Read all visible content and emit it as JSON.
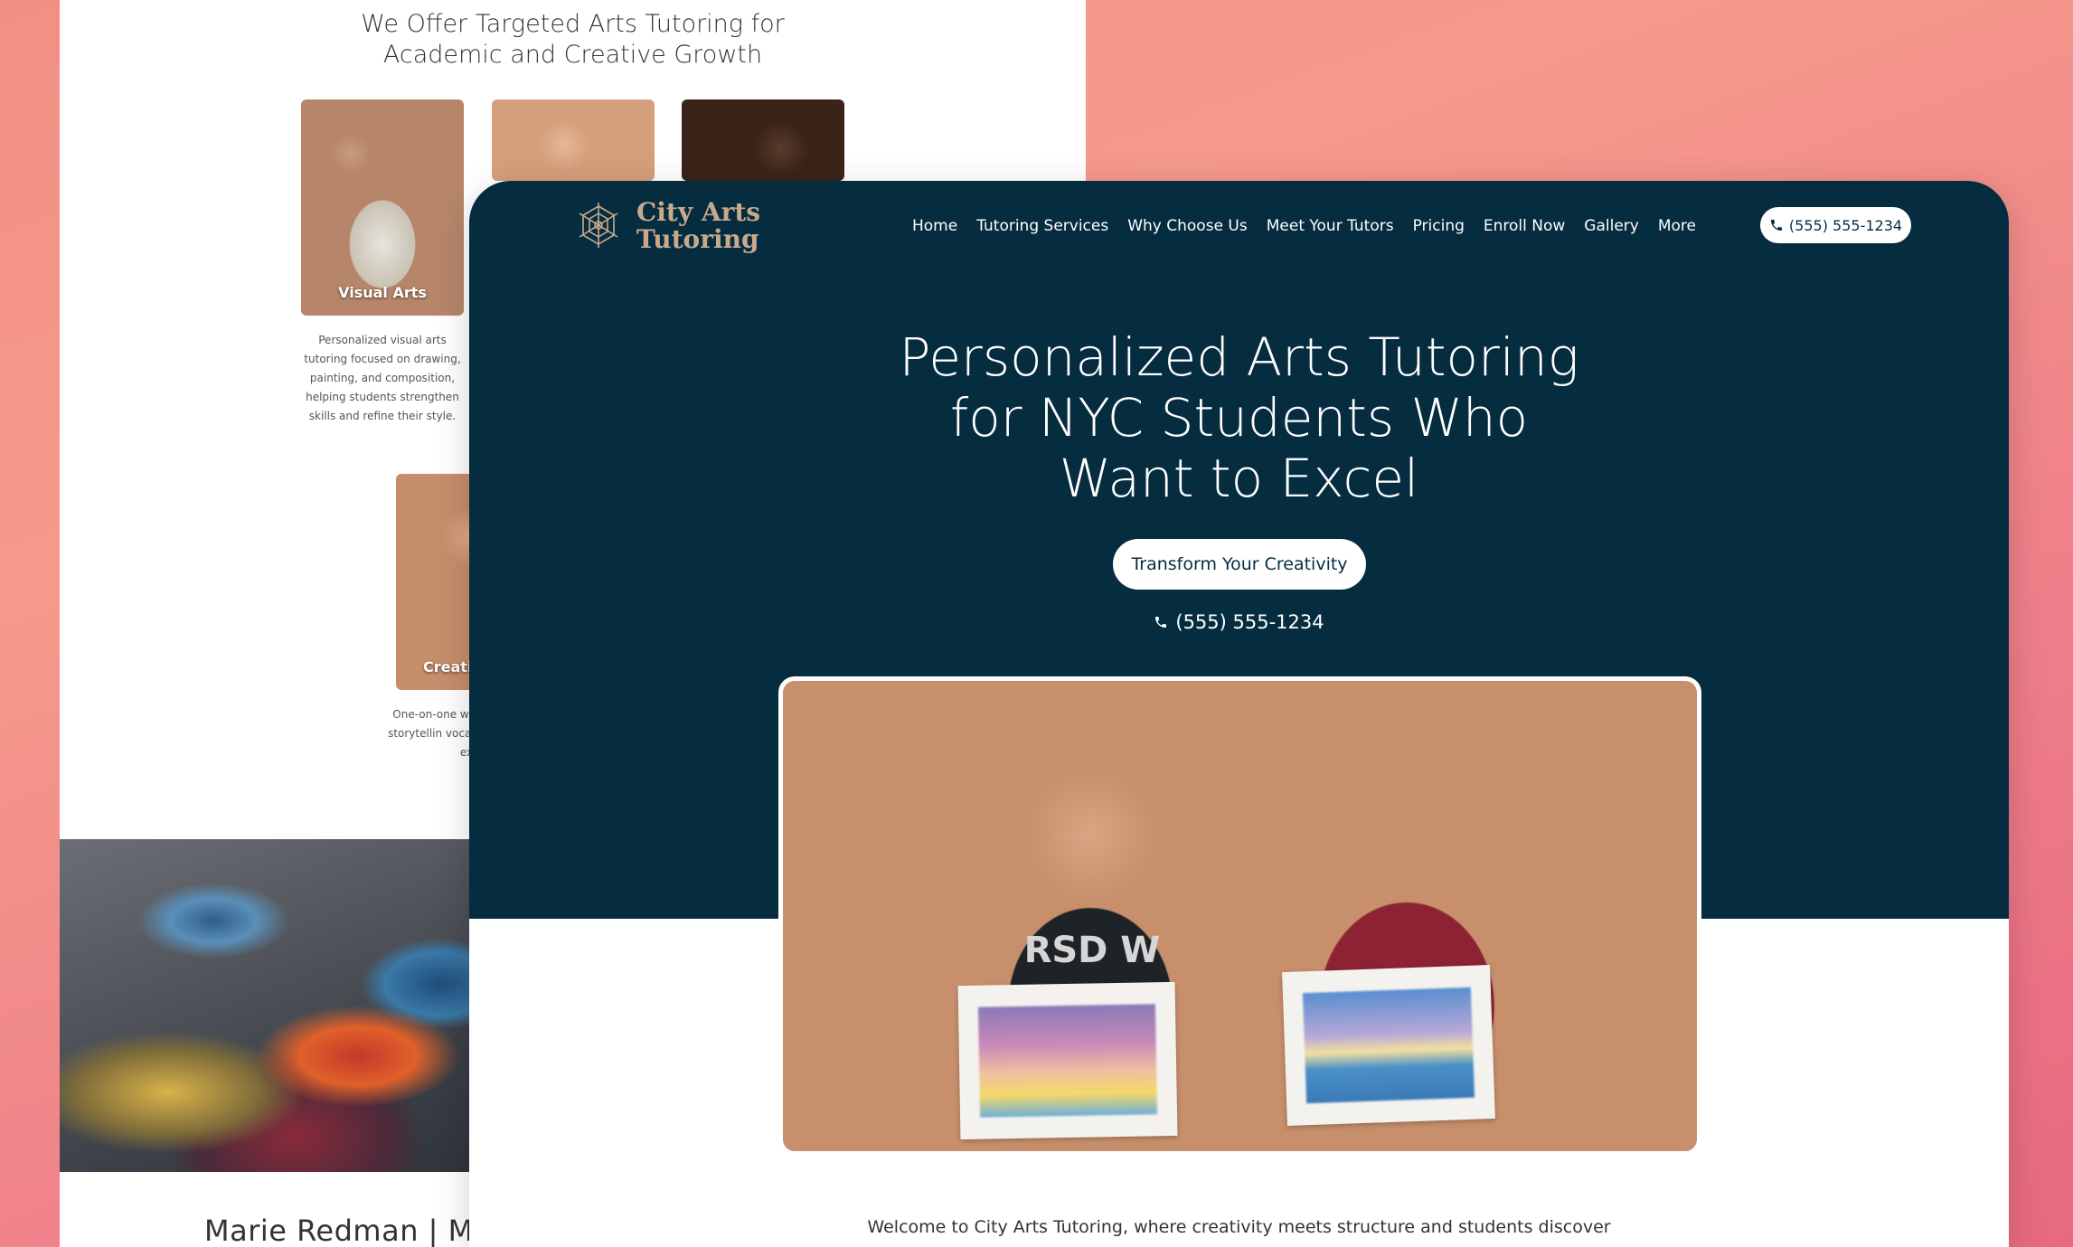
{
  "back_page": {
    "heading_line1": "We Offer Targeted Arts Tutoring for",
    "heading_line2": "Academic and Creative Growth",
    "cards": [
      {
        "label": "Visual Arts",
        "description": "Personalized visual arts tutoring focused on drawing, painting, and composition, helping students strengthen skills and refine their style."
      },
      {
        "label": "Creativ",
        "description": "One-on-one w that helps st storytellin vocabulary, a self-ex"
      }
    ],
    "name_text": "Marie Redman | Mu"
  },
  "header": {
    "logo_line1": "City Arts",
    "logo_line2": "Tutoring",
    "logo_icon": "mandala-logo-icon",
    "nav": [
      "Home",
      "Tutoring Services",
      "Why Choose Us",
      "Meet Your Tutors",
      "Pricing",
      "Enroll Now",
      "Gallery",
      "More"
    ],
    "phone": "(555) 555-1234",
    "phone_icon": "phone-icon"
  },
  "hero": {
    "title_line1": "Personalized Arts Tutoring",
    "title_line2": "for  NYC Students Who",
    "title_line3": "Want to  Excel",
    "cta_label": "Transform Your Creativity",
    "phone": "(555) 555-1234",
    "shirt_text": "RSD W"
  },
  "welcome_text": "Welcome to City Arts Tutoring, where creativity meets structure and students discover",
  "colors": {
    "navy": "#062c40",
    "logo_tan": "#c9a98c",
    "background_coral": "#f28f84"
  }
}
